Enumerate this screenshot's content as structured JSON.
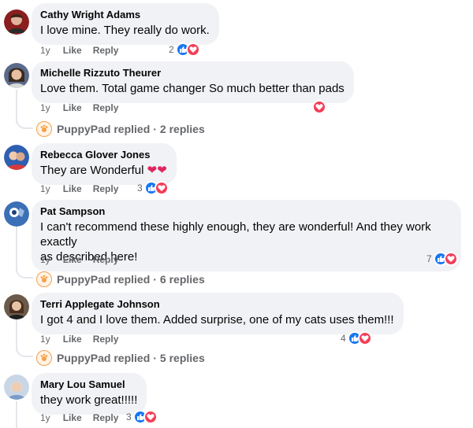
{
  "comments": [
    {
      "author": "Cathy Wright Adams",
      "text": "I love mine. They really do work.",
      "age": "1y",
      "like": "Like",
      "reply": "Reply",
      "reactions_count": "2"
    },
    {
      "author": "Michelle Rizzuto Theurer",
      "text": "Love them. Total game changer So much better than pads",
      "age": "1y",
      "like": "Like",
      "reply": "Reply",
      "reactions_count": "",
      "replies": {
        "name": "PuppyPad replied",
        "dot": "·",
        "count": "2 replies"
      }
    },
    {
      "author": "Rebecca Glover Jones",
      "text": "They are Wonderful",
      "age": "1y",
      "like": "Like",
      "reply": "Reply",
      "reactions_count": "3"
    },
    {
      "author": "Pat Sampson",
      "text_line1": "I can't recommend these highly enough, they are wonderful! And they work exactly",
      "text_line2": "as described here!",
      "age": "1y",
      "like": "Like",
      "reply": "Reply",
      "reactions_count": "7",
      "replies": {
        "name": "PuppyPad replied",
        "dot": "·",
        "count": "6 replies"
      }
    },
    {
      "author": "Terri Applegate Johnson",
      "text": "I got 4 and I love them. Added surprise, one of my cats uses them!!!",
      "age": "1y",
      "like": "Like",
      "reply": "Reply",
      "reactions_count": "4",
      "replies": {
        "name": "PuppyPad replied",
        "dot": "·",
        "count": "5 replies"
      }
    },
    {
      "author": "Mary Lou Samuel",
      "text": "they work great!!!!!",
      "age": "1y",
      "like": "Like",
      "reply": "Reply",
      "reactions_count": "3"
    }
  ],
  "icons": {
    "like": "thumbs-up-icon",
    "love": "heart-icon"
  },
  "colors": {
    "like": "#1877f2",
    "love": "#f33e58",
    "bubble": "#f0f2f5",
    "meta": "#65676b"
  }
}
